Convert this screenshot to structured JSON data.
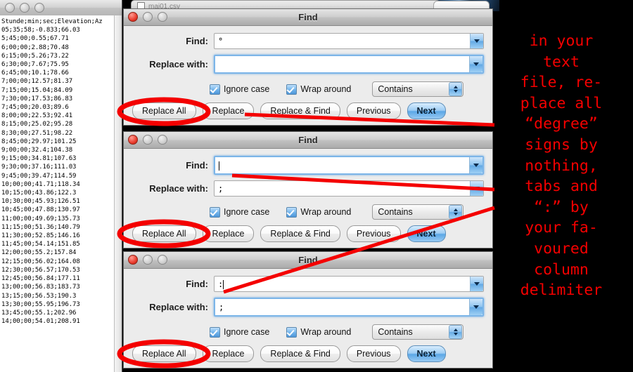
{
  "window_editor": {
    "name": "text-file-window",
    "title": "mai01.csv",
    "lines": [
      "Stunde;min;sec;Elevation;Az",
      "05;35;58;-0.833;66.03",
      "5;45;00;0.55;67.71",
      "6;00;00;2.88;70.48",
      "6;15;00;5.26;73.22",
      "6;30;00;7.67;75.95",
      "6;45;00;10.1;78.66",
      "7;00;00;12.57;81.37",
      "7;15;00;15.04;84.09",
      "7;30;00;17.53;86.83",
      "7;45;00;20.03;89.6",
      "8;00;00;22.53;92.41",
      "8;15;00;25.02;95.28",
      "8;30;00;27.51;98.22",
      "8;45;00;29.97;101.25",
      "9;00;00;32.4;104.38",
      "9;15;00;34.81;107.63",
      "9;30;00;37.16;111.03",
      "9;45;00;39.47;114.59",
      "10;00;00;41.71;118.34",
      "10;15;00;43.86;122.3",
      "10;30;00;45.93;126.51",
      "10;45;00;47.88;130.97",
      "11;00;00;49.69;135.73",
      "11;15;00;51.36;140.79",
      "11;30;00;52.85;146.16",
      "11;45;00;54.14;151.85",
      "12;00;00;55.2;157.84",
      "12;15;00;56.02;164.08",
      "12;30;00;56.57;170.53",
      "12;45;00;56.84;177.11",
      "13;00;00;56.83;183.73",
      "13;15;00;56.53;190.3",
      "13;30;00;55.95;196.73",
      "13;45;00;55.1;202.96",
      "14;00;00;54.01;208.91"
    ]
  },
  "common": {
    "title": "Find",
    "find_label": "Find:",
    "replace_label": "Replace with:",
    "ignore_case_label": "Ignore case",
    "wrap_around_label": "Wrap around",
    "match_mode": "Contains",
    "buttons": {
      "replace_all": "Replace All",
      "replace": "Replace",
      "replace_and_find": "Replace & Find",
      "previous": "Previous",
      "next": "Next"
    }
  },
  "dialogs": [
    {
      "id": "find-dialog-degree",
      "find_value": "°",
      "replace_value": "",
      "find_focused": false,
      "replace_focused": true,
      "find_caret": false,
      "replace_caret": false
    },
    {
      "id": "find-dialog-tab",
      "find_value": "",
      "replace_value": ";",
      "find_focused": true,
      "replace_focused": false,
      "find_caret": true,
      "replace_caret": false
    },
    {
      "id": "find-dialog-colon",
      "find_value": ":",
      "replace_value": ";",
      "find_focused": false,
      "replace_focused": true,
      "find_caret": true,
      "replace_caret": false
    }
  ],
  "annotation": {
    "color": "#f40000",
    "text": "in your text file, re-place all “degree” signs by nothing, tabs and “:” by your fa-voured column delimiter",
    "lines": [
      "in your",
      "text",
      "file, re-",
      "place all",
      "“degree”",
      "signs by",
      "nothing,",
      "tabs and",
      "“:” by",
      "your fa-",
      "voured",
      "column",
      "delimiter"
    ]
  }
}
